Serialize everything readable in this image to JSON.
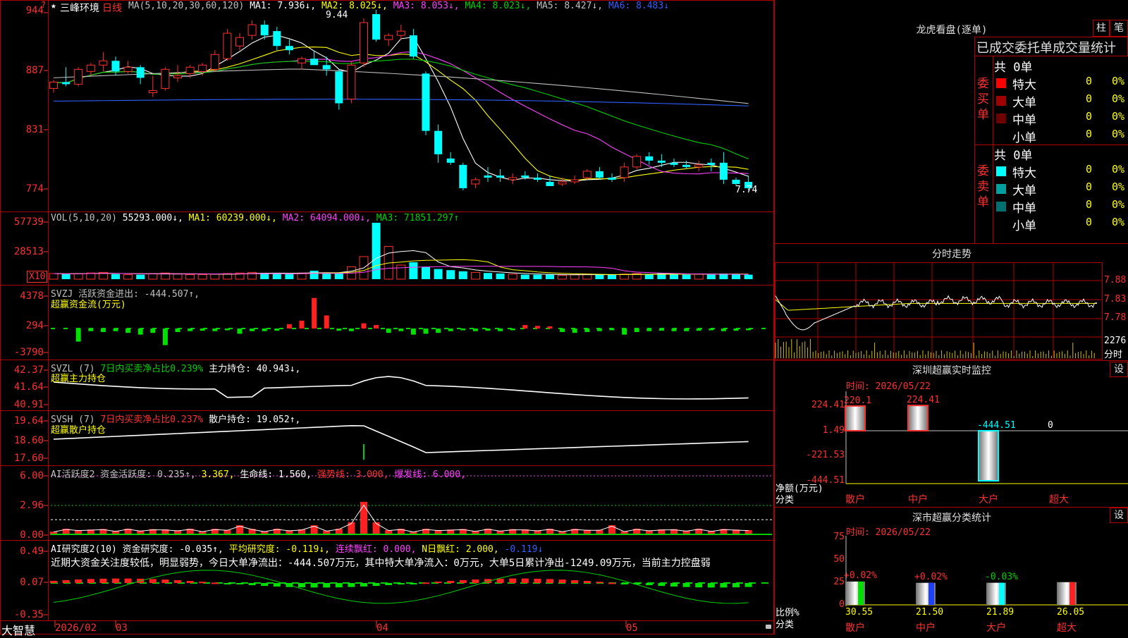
{
  "stock": {
    "name": "三峰环境",
    "period": "日线",
    "star": "★",
    "flag": "?"
  },
  "main": {
    "yticks": [
      "944",
      "887",
      "831",
      "774"
    ],
    "legend": [
      {
        "text": "MA(5,10,20,30,60,120)",
        "color": "#c0c0c0"
      },
      {
        "text": "MA1: 7.936↓,",
        "color": "#ffffff"
      },
      {
        "text": "MA2: 8.025↓,",
        "color": "#ffff00"
      },
      {
        "text": "MA3: 8.053↓,",
        "color": "#ff40ff"
      },
      {
        "text": "MA4: 8.023↓,",
        "color": "#00d000"
      },
      {
        "text": "MA5: 8.427↓,",
        "color": "#c0c0c0"
      },
      {
        "text": "MA6: 8.483↓",
        "color": "#3060ff"
      }
    ],
    "high_label": "9.44",
    "low_label": "7.74"
  },
  "vol": {
    "yticks": [
      "57739",
      "28513"
    ],
    "unit": "X10",
    "legend": [
      {
        "text": "VOL(5,10,20)",
        "color": "#c0c0c0"
      },
      {
        "text": "55293.000↓,",
        "color": "#ffffff"
      },
      {
        "text": "MA1: 60239.000↓,",
        "color": "#ffff00"
      },
      {
        "text": "MA2: 64094.000↓,",
        "color": "#ff40ff"
      },
      {
        "text": "MA3: 71851.297↑",
        "color": "#00d000"
      }
    ]
  },
  "svzj": {
    "yticks": [
      "4378",
      "294",
      "-3790"
    ],
    "legend": [
      {
        "text": "SVZJ  活跃资金进出: -444.507↑,",
        "color": "#c0c0c0"
      }
    ],
    "sub": "超赢资金流(万元)"
  },
  "svzl": {
    "yticks": [
      "42.37",
      "41.64",
      "40.91"
    ],
    "legend": [
      {
        "text": "SVZL (7)",
        "color": "#c0c0c0"
      },
      {
        "text": "7日内买卖净占比0.239%",
        "color": "#00d000"
      },
      {
        "text": "主力持仓: 40.943↓,",
        "color": "#ffffff"
      }
    ],
    "sub": "超赢主力持仓"
  },
  "svsh": {
    "yticks": [
      "19.64",
      "18.60",
      "17.60"
    ],
    "legend": [
      {
        "text": "SVSH (7)",
        "color": "#c0c0c0"
      },
      {
        "text": "7日内买卖净占比0.237%",
        "color": "#ff3030"
      },
      {
        "text": "散户持仓: 19.052↑,",
        "color": "#ffffff"
      }
    ],
    "sub": "超赢散户持仓"
  },
  "ai1": {
    "yticks": [
      "6.00",
      "2.96",
      "0.00"
    ],
    "legend": [
      {
        "text": "AI活跃度2 资金活跃度: 0.235↑,",
        "color": "#c0c0c0"
      },
      {
        "text": "3.367,",
        "color": "#ffff00"
      },
      {
        "text": "生命线: 1.560,",
        "color": "#ffffff"
      },
      {
        "text": "强势线: 3.000,",
        "color": "#ff3030"
      },
      {
        "text": "爆发线: 6.000,",
        "color": "#ff40ff"
      }
    ]
  },
  "ai2": {
    "yticks": [
      "0.49",
      "0.07",
      "-0.35"
    ],
    "legend": [
      {
        "text": "AI研究度2(10) 资金研究度: -0.035↑,",
        "color": "#ffffff"
      },
      {
        "text": "平均研究度: -0.119↓,",
        "color": "#ffff00"
      },
      {
        "text": "连续飘红: 0.000,",
        "color": "#ff40ff"
      },
      {
        "text": "N日飘红: 2.000,",
        "color": "#ffff00"
      },
      {
        "text": "-0.119↓",
        "color": "#3060ff"
      }
    ],
    "comment": "近期大资金关注度较低，明显弱势，今日大单净流出：-444.507万元，其中特大单净流入：0万元，大单5日累计净出-1249.09万元，当前主力控盘弱"
  },
  "xaxis": {
    "brand": "大智慧",
    "labels": [
      "2026/02",
      "03",
      "04",
      "05"
    ]
  },
  "lhb": {
    "title": "龙虎看盘(逐单)",
    "btn1": "柱",
    "btn2": "笔",
    "header": "已成交委托单成交量统计",
    "buy_label": "委买单",
    "sell_label": "委卖单",
    "buy_total": "共 0单",
    "sell_total": "共 0单",
    "buy_rows": [
      {
        "name": "特大",
        "count": "0",
        "pct": "0%",
        "color": "#ff0000"
      },
      {
        "name": "大单",
        "count": "0",
        "pct": "0%",
        "color": "#a00000"
      },
      {
        "name": "中单",
        "count": "0",
        "pct": "0%",
        "color": "#700000"
      },
      {
        "name": "小单",
        "count": "0",
        "pct": "0%",
        "color": ""
      }
    ],
    "sell_rows": [
      {
        "name": "特大",
        "count": "0",
        "pct": "0%",
        "color": "#00ffff"
      },
      {
        "name": "大单",
        "count": "0",
        "pct": "0%",
        "color": "#00a0a0"
      },
      {
        "name": "中单",
        "count": "0",
        "pct": "0%",
        "color": "#007070"
      },
      {
        "name": "小单",
        "count": "0",
        "pct": "0%",
        "color": ""
      }
    ]
  },
  "intraday": {
    "title": "分时走势",
    "yticks": [
      "7.88",
      "7.83",
      "7.78"
    ],
    "vol_tick": "2276",
    "vol_label": "分时"
  },
  "monitor": {
    "title": "深圳超赢实时监控",
    "btn": "设",
    "time": "时间: 2026/05/22",
    "yticks": [
      "224.41",
      "1.49",
      "-221.53",
      "-444.51"
    ],
    "ylabel": "净额(万元)",
    "xlabel": "分类",
    "categories": [
      "散户",
      "中户",
      "大户",
      "超大"
    ],
    "values": [
      220.1,
      224.41,
      -444.51,
      0
    ],
    "value_labels": [
      "220.1",
      "224.41",
      "-444.51",
      "0"
    ]
  },
  "classify": {
    "title": "深市超赢分类统计",
    "btn": "设",
    "time": "时间: 2026/05/22",
    "yticks": [
      "75",
      "50",
      "25",
      "0"
    ],
    "ylabel": "比例%",
    "xlabel": "分类",
    "categories": [
      "散户",
      "中户",
      "大户",
      "超大"
    ],
    "values": [
      30.55,
      21.5,
      21.89,
      26.05
    ],
    "value_labels": [
      "30.55",
      "21.50",
      "21.89",
      "26.05"
    ],
    "change_labels": [
      "+0.02%",
      "+0.02%",
      "-0.03%",
      ""
    ]
  },
  "chart_data": [
    {
      "type": "candlestick",
      "title": "三峰环境 日线",
      "ylim": [
        7.74,
        9.44
      ],
      "x": [
        "2026/02",
        "03",
        "04",
        "05"
      ],
      "ohlc": [
        [
          8.7,
          8.78,
          8.66,
          8.76
        ],
        [
          8.76,
          8.9,
          8.72,
          8.74
        ],
        [
          8.74,
          8.9,
          8.72,
          8.88
        ],
        [
          8.86,
          8.94,
          8.82,
          8.92
        ],
        [
          8.92,
          9.04,
          8.86,
          8.96
        ],
        [
          8.96,
          9.0,
          8.82,
          8.86
        ],
        [
          8.86,
          8.96,
          8.84,
          8.9
        ],
        [
          8.9,
          8.92,
          8.74,
          8.8
        ],
        [
          8.66,
          8.82,
          8.62,
          8.68
        ],
        [
          8.7,
          8.9,
          8.68,
          8.88
        ],
        [
          8.8,
          8.92,
          8.76,
          8.82
        ],
        [
          8.84,
          8.92,
          8.8,
          8.9
        ],
        [
          8.86,
          8.94,
          8.82,
          8.92
        ],
        [
          8.88,
          9.06,
          8.86,
          9.02
        ],
        [
          8.98,
          9.26,
          8.96,
          9.22
        ],
        [
          9.1,
          9.22,
          9.06,
          9.18
        ],
        [
          9.2,
          9.34,
          9.16,
          9.3
        ],
        [
          9.3,
          9.34,
          9.16,
          9.2
        ],
        [
          9.24,
          9.28,
          9.06,
          9.1
        ],
        [
          9.1,
          9.16,
          9.02,
          9.06
        ],
        [
          8.94,
          9.0,
          8.88,
          8.98
        ],
        [
          8.98,
          9.06,
          8.92,
          8.92
        ],
        [
          8.92,
          9.0,
          8.82,
          8.88
        ],
        [
          8.86,
          8.88,
          8.5,
          8.56
        ],
        [
          8.6,
          8.96,
          8.56,
          8.92
        ],
        [
          8.94,
          9.36,
          8.9,
          9.32
        ],
        [
          9.4,
          9.44,
          9.14,
          9.16
        ],
        [
          9.16,
          9.22,
          9.1,
          9.2
        ],
        [
          9.2,
          9.3,
          9.16,
          9.24
        ],
        [
          9.2,
          9.26,
          8.98,
          9.0
        ],
        [
          8.84,
          8.86,
          8.26,
          8.3
        ],
        [
          8.3,
          8.36,
          8.0,
          8.08
        ],
        [
          8.04,
          8.1,
          7.98,
          8.0
        ],
        [
          7.98,
          8.0,
          7.74,
          7.76
        ],
        [
          7.8,
          7.86,
          7.76,
          7.84
        ],
        [
          7.88,
          7.96,
          7.82,
          7.86
        ],
        [
          7.88,
          7.94,
          7.82,
          7.86
        ],
        [
          7.84,
          7.9,
          7.8,
          7.86
        ],
        [
          7.88,
          7.92,
          7.84,
          7.86
        ],
        [
          7.86,
          7.9,
          7.82,
          7.84
        ],
        [
          7.82,
          7.88,
          7.78,
          7.78
        ],
        [
          7.8,
          7.86,
          7.78,
          7.82
        ],
        [
          7.82,
          7.88,
          7.8,
          7.84
        ],
        [
          7.86,
          7.94,
          7.84,
          7.92
        ],
        [
          7.92,
          7.96,
          7.84,
          7.86
        ],
        [
          7.86,
          7.9,
          7.82,
          7.84
        ],
        [
          7.86,
          8.0,
          7.82,
          7.96
        ],
        [
          7.96,
          8.08,
          7.94,
          8.06
        ],
        [
          8.06,
          8.1,
          7.98,
          8.02
        ],
        [
          8.02,
          8.08,
          7.96,
          8.0
        ],
        [
          8.0,
          8.04,
          7.96,
          7.98
        ],
        [
          7.98,
          8.02,
          7.94,
          7.96
        ],
        [
          7.96,
          8.02,
          7.92,
          7.98
        ],
        [
          8.0,
          8.04,
          7.92,
          7.98
        ],
        [
          8.0,
          8.1,
          7.8,
          7.84
        ],
        [
          7.84,
          7.86,
          7.78,
          7.8
        ],
        [
          7.82,
          7.88,
          7.74,
          7.76
        ]
      ]
    },
    {
      "type": "bar",
      "title": "VOL",
      "values": [
        10,
        9,
        10,
        11,
        12,
        9,
        8,
        8,
        10,
        11,
        9,
        8,
        8,
        9,
        10,
        11,
        12,
        11,
        10,
        9,
        11,
        15,
        12,
        11,
        22,
        40,
        100,
        58,
        25,
        30,
        22,
        18,
        16,
        14,
        12,
        11,
        10,
        9,
        8,
        8,
        8,
        7,
        8,
        9,
        8,
        8,
        9,
        10,
        9,
        11,
        9,
        8,
        9,
        8,
        10,
        9,
        8
      ]
    },
    {
      "type": "bar",
      "title": "SVZJ",
      "values": [
        0,
        0,
        -30,
        -6,
        -8,
        -6,
        -10,
        -14,
        -10,
        -38,
        -8,
        -6,
        -5,
        -6,
        -4,
        -12,
        -6,
        -6,
        -5,
        10,
        18,
        70,
        30,
        -5,
        -6,
        12,
        8,
        -10,
        -6,
        -14,
        -12,
        -10,
        -6,
        -4,
        -6,
        -5,
        -6,
        -4,
        8,
        6,
        5,
        -8,
        -10,
        -8,
        -6,
        -4,
        -14,
        -8,
        -6,
        -5,
        -6,
        -6,
        -5,
        -4,
        -6,
        -5,
        -4
      ]
    },
    {
      "type": "line",
      "title": "SVZL 主力持仓",
      "ylim": [
        40.91,
        42.37
      ]
    },
    {
      "type": "line",
      "title": "SVSH 散户持仓",
      "ylim": [
        17.6,
        19.64
      ]
    },
    {
      "type": "bar",
      "title": "AI活跃度2",
      "ylim": [
        0,
        6
      ]
    },
    {
      "type": "bar",
      "title": "AI研究度2",
      "ylim": [
        -0.35,
        0.49
      ]
    },
    {
      "type": "bar",
      "title": "深圳超赢实时监控",
      "categories": [
        "散户",
        "中户",
        "大户",
        "超大"
      ],
      "values": [
        220.1,
        224.41,
        -444.51,
        0
      ]
    },
    {
      "type": "bar",
      "title": "深市超赢分类统计",
      "categories": [
        "散户",
        "中户",
        "大户",
        "超大"
      ],
      "values": [
        30.55,
        21.5,
        21.89,
        26.05
      ]
    }
  ]
}
